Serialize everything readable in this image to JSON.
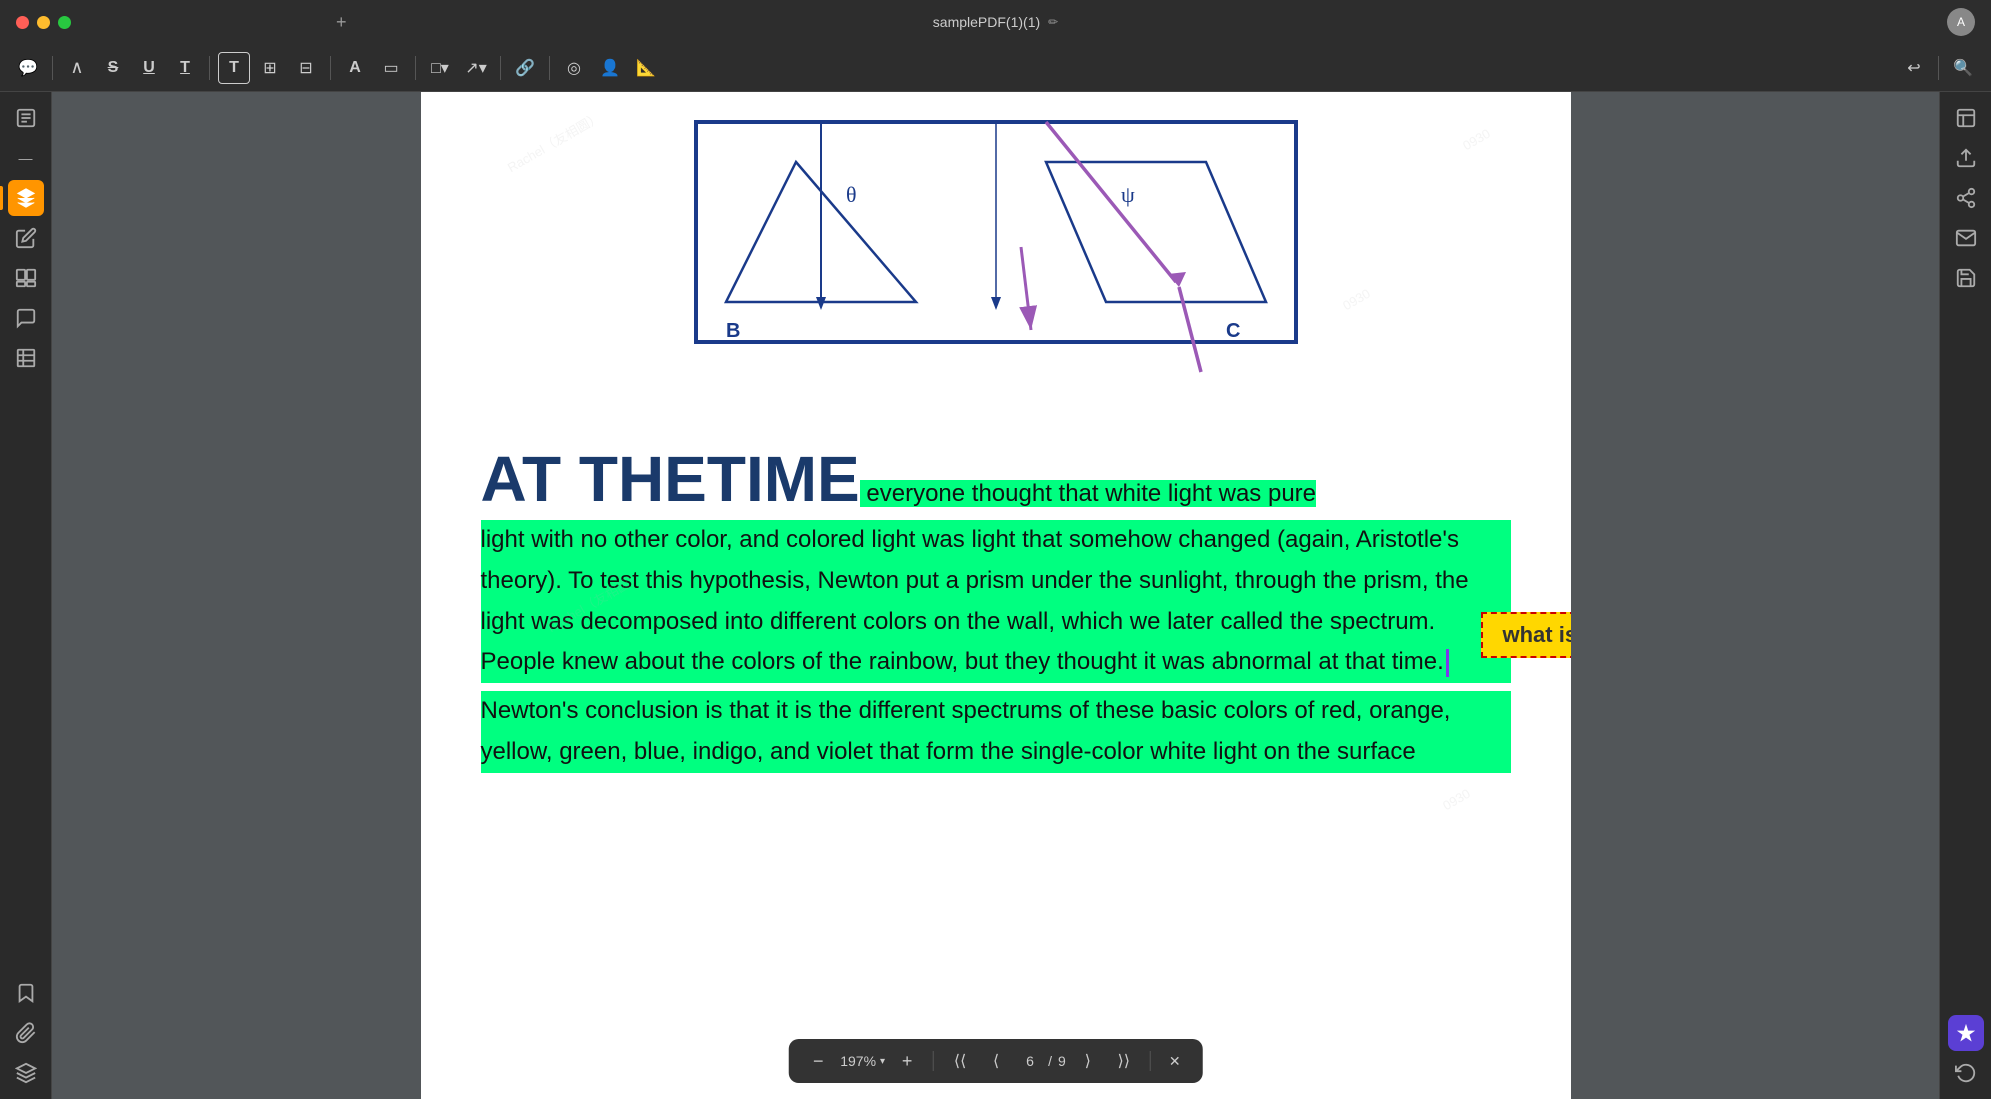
{
  "titlebar": {
    "title": "samplePDF(1)(1)",
    "plus_label": "+",
    "avatar_initial": "A"
  },
  "toolbar": {
    "icons": [
      {
        "name": "comment-icon",
        "symbol": "💬"
      },
      {
        "name": "arc-icon",
        "symbol": "∧"
      },
      {
        "name": "strikethrough-icon",
        "symbol": "S"
      },
      {
        "name": "underline-icon",
        "symbol": "U"
      },
      {
        "name": "text-icon",
        "symbol": "T"
      },
      {
        "name": "text-box-icon",
        "symbol": "T"
      },
      {
        "name": "text-frame-icon",
        "symbol": "⊞"
      },
      {
        "name": "table-icon",
        "symbol": "⊟"
      },
      {
        "name": "font-color-icon",
        "symbol": "A"
      },
      {
        "name": "fill-color-icon",
        "symbol": "▱"
      },
      {
        "name": "shape-icon",
        "symbol": "□"
      },
      {
        "name": "line-icon",
        "symbol": "⌐"
      },
      {
        "name": "link-icon",
        "symbol": "🔗"
      },
      {
        "name": "stamp-icon",
        "symbol": "◎"
      },
      {
        "name": "person-icon",
        "symbol": "👤"
      },
      {
        "name": "measure-icon",
        "symbol": "📏"
      },
      {
        "name": "undo-icon",
        "symbol": "↩"
      },
      {
        "name": "search-icon",
        "symbol": "🔍"
      }
    ]
  },
  "left_sidebar": {
    "items": [
      {
        "name": "read-icon",
        "symbol": "📖",
        "active": false
      },
      {
        "name": "collapse-icon",
        "symbol": "—",
        "active": false
      },
      {
        "name": "highlight-icon",
        "symbol": "🖊",
        "active": true
      },
      {
        "name": "edit-icon",
        "symbol": "✏️",
        "active": false
      },
      {
        "name": "pages-icon",
        "symbol": "⊞",
        "active": false
      },
      {
        "name": "comment-list-icon",
        "symbol": "📋",
        "active": false
      },
      {
        "name": "table-icon",
        "symbol": "⊟",
        "active": false
      },
      {
        "name": "bookmark-icon",
        "symbol": "🔖",
        "active": false
      },
      {
        "name": "attachment-icon",
        "symbol": "📎",
        "active": false
      },
      {
        "name": "layers-icon",
        "symbol": "◧",
        "active": false
      }
    ]
  },
  "right_sidebar": {
    "items": [
      {
        "name": "import-icon",
        "symbol": "⊡"
      },
      {
        "name": "export-icon",
        "symbol": "↑"
      },
      {
        "name": "share-icon",
        "symbol": "⊕"
      },
      {
        "name": "mail-icon",
        "symbol": "✉"
      },
      {
        "name": "save-icon",
        "symbol": "💾"
      },
      {
        "name": "ai-icon",
        "symbol": "✦"
      },
      {
        "name": "undo2-icon",
        "symbol": "↩"
      }
    ]
  },
  "annotation": {
    "label": "what is UPDF"
  },
  "content": {
    "heading": "AT THETIME",
    "paragraph1": "everyone thought that white light was pure light with no other color, and colored light was light that somehow changed (again, Aristotle's theory). To test this hypothesis, Newton put a prism under the sunlight, through the prism, the light was decomposed into different colors on the wall, which we later called the spectrum. People knew about the colors of the rainbow, but they thought it was abnormal at that time.",
    "paragraph2": "Newton's conclusion is that it is the different spectrums of these basic colors of red, orange, yellow, green, blue, indigo, and violet that form the single-color white light on the surface"
  },
  "bottom_toolbar": {
    "zoom": "197%",
    "current_page": "6",
    "total_pages": "9",
    "zoom_out": "−",
    "zoom_in": "+",
    "first_page": "⟨⟨",
    "prev_page": "⟨",
    "next_page": "⟩",
    "last_page": "⟩⟩",
    "close": "✕"
  },
  "watermark": {
    "text": "Rachel（友相圆）",
    "numbers": "0930"
  }
}
